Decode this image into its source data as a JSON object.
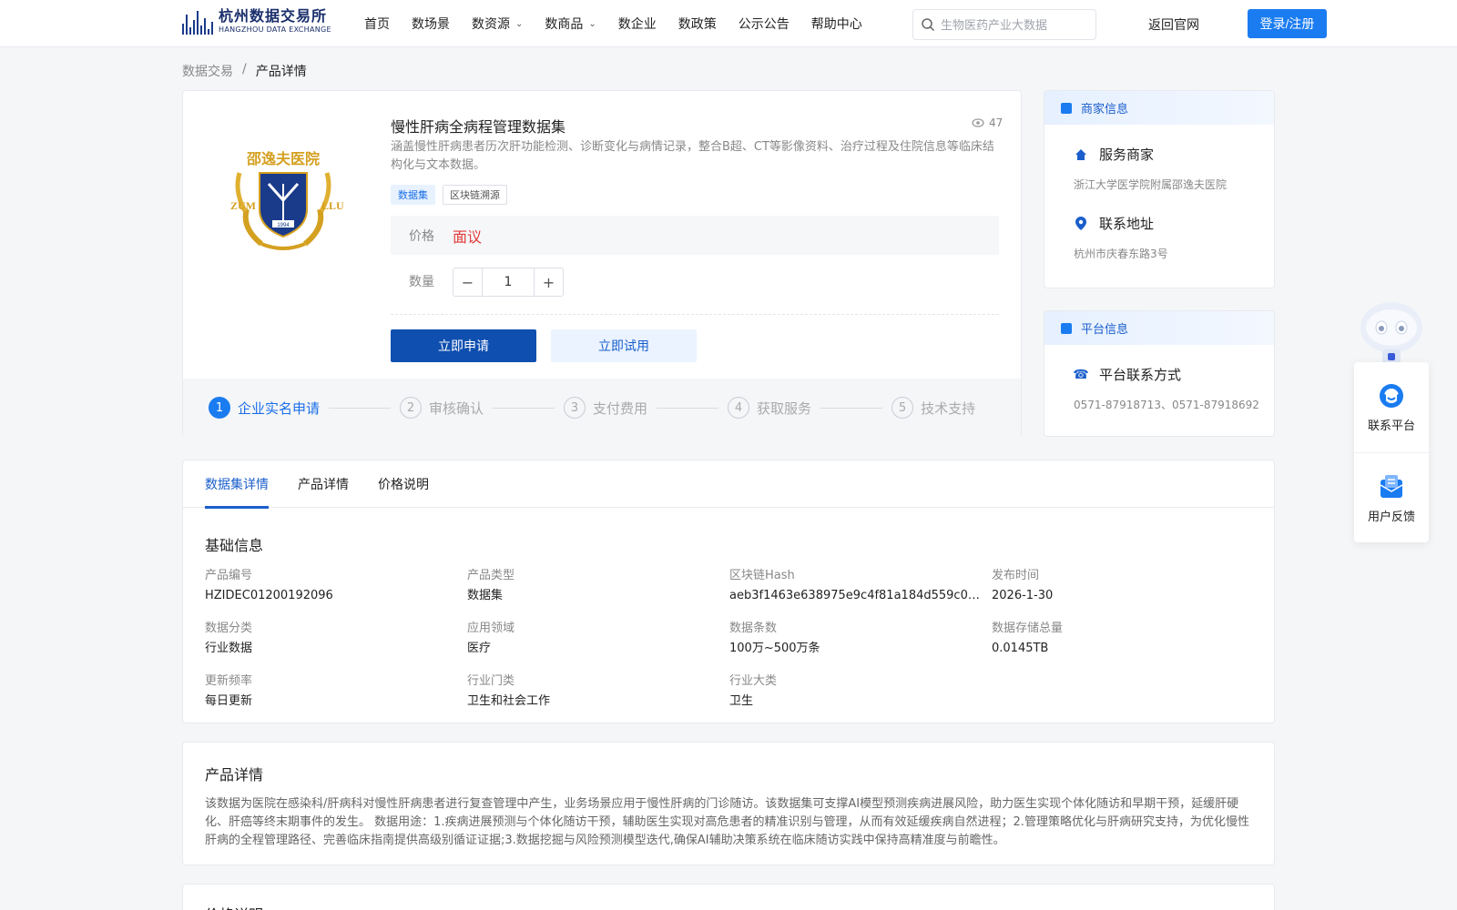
{
  "header": {
    "logo_cn": "杭州数据交易所",
    "logo_en": "HANGZHOU DATA EXCHANGE",
    "nav": [
      {
        "label": "首页",
        "dropdown": false
      },
      {
        "label": "数场景",
        "dropdown": false
      },
      {
        "label": "数资源",
        "dropdown": true
      },
      {
        "label": "数商品",
        "dropdown": true
      },
      {
        "label": "数企业",
        "dropdown": false
      },
      {
        "label": "数政策",
        "dropdown": false
      },
      {
        "label": "公示公告",
        "dropdown": false
      },
      {
        "label": "帮助中心",
        "dropdown": false
      }
    ],
    "search_placeholder": "生物医药产业大数据",
    "back_label": "返回官网",
    "login_label": "登录/注册"
  },
  "breadcrumb": {
    "root": "数据交易",
    "sep": "/",
    "current": "产品详情"
  },
  "product": {
    "logo_text_top": "邵逸夫医院",
    "logo_year": "1994",
    "title": "慢性肝病全病程管理数据集",
    "views": "47",
    "description": "涵盖慢性肝病患者历次肝功能检测、诊断变化与病情记录，整合B超、CT等影像资料、治疗过程及住院信息等临床结构化与文本数据。",
    "tags": [
      "数据集",
      "区块链溯源"
    ],
    "price_label": "价格",
    "price_value": "面议",
    "qty_label": "数量",
    "qty_value": "1",
    "apply_label": "立即申请",
    "try_label": "立即试用",
    "steps": [
      {
        "num": "1",
        "label": "企业实名申请",
        "active": true
      },
      {
        "num": "2",
        "label": "审核确认",
        "active": false
      },
      {
        "num": "3",
        "label": "支付费用",
        "active": false
      },
      {
        "num": "4",
        "label": "获取服务",
        "active": false
      },
      {
        "num": "5",
        "label": "技术支持",
        "active": false
      }
    ]
  },
  "merchant": {
    "head": "商家信息",
    "service_title": "服务商家",
    "service_value": "浙江大学医学院附属邵逸夫医院",
    "address_title": "联系地址",
    "address_value": "杭州市庆春东路3号"
  },
  "platform": {
    "head": "平台信息",
    "contact_title": "平台联系方式",
    "contact_value": "0571-87918713、0571-87918692"
  },
  "tabs": [
    "数据集详情",
    "产品详情",
    "价格说明"
  ],
  "basic": {
    "title": "基础信息",
    "fields": [
      {
        "label": "产品编号",
        "value": "HZIDEC01200192096"
      },
      {
        "label": "产品类型",
        "value": "数据集"
      },
      {
        "label": "区块链Hash",
        "value": "aeb3f1463e638975e9c4f81a184d559c0ff2…"
      },
      {
        "label": "发布时间",
        "value": "2026-1-30"
      },
      {
        "label": "数据分类",
        "value": "行业数据"
      },
      {
        "label": "应用领域",
        "value": "医疗"
      },
      {
        "label": "数据条数",
        "value": "100万~500万条"
      },
      {
        "label": "数据存储总量",
        "value": "0.0145TB"
      },
      {
        "label": "更新频率",
        "value": "每日更新"
      },
      {
        "label": "行业门类",
        "value": "卫生和社会工作"
      },
      {
        "label": "行业大类",
        "value": "卫生"
      }
    ]
  },
  "detail": {
    "title": "产品详情",
    "text": "该数据为医院在感染科/肝病科对慢性肝病患者进行复查管理中产生，业务场景应用于慢性肝病的门诊随访。该数据集可支撑AI模型预测疾病进展风险，助力医生实现个体化随访和早期干预，延缓肝硬化、肝癌等终末期事件的发生。 数据用途：1.疾病进展预测与个体化随访干预，辅助医生实现对高危患者的精准识别与管理，从而有效延缓疾病自然进程；2.管理策略优化与肝病研究支持，为优化慢性肝病的全程管理路径、完善临床指南提供高级别循证证据;3.数据挖掘与风险预测模型迭代,确保AI辅助决策系统在临床随访实践中保持高精准度与前瞻性。"
  },
  "price_section": {
    "title": "价格详明"
  },
  "float": {
    "contact": "联系平台",
    "feedback": "用户反馈"
  },
  "colors": {
    "primary": "#1a7cf0",
    "dark_primary": "#0f4fb0",
    "price": "#e03a3a"
  }
}
